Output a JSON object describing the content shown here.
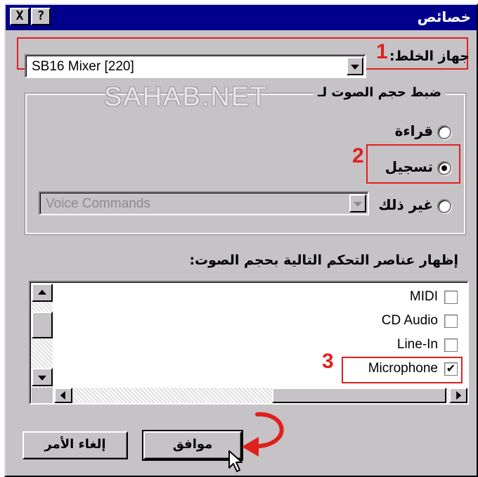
{
  "window": {
    "title": "خصائص",
    "close_glyph": "X",
    "help_glyph": "?"
  },
  "mixer_device": {
    "label": "جهاز الخلط:",
    "value": "SB16 Mixer [220]"
  },
  "volume_group": {
    "title": "ضبط حجم الصوت لـ",
    "options": [
      {
        "label": "قراءة",
        "checked": false
      },
      {
        "label": "تسجيل",
        "checked": true
      },
      {
        "label": "غير ذلك",
        "checked": false
      }
    ],
    "other_value": "Voice Commands"
  },
  "watermark": "SAHAB.NET",
  "controls_list": {
    "label": "إظهار عناصر التحكم التالية بحجم الصوت:",
    "items": [
      {
        "label": "MIDI",
        "checked": false
      },
      {
        "label": "CD Audio",
        "checked": false
      },
      {
        "label": "Line-In",
        "checked": false
      },
      {
        "label": "Microphone",
        "checked": true
      }
    ]
  },
  "buttons": {
    "ok": "موافق",
    "cancel": "إلغاء الأمر"
  },
  "annotations": [
    "1",
    "2",
    "3"
  ],
  "colors": {
    "dialog_bg": "#c6c3c6",
    "titlebar": "#00008c",
    "annotation": "#e0201c"
  },
  "icons": {
    "close": "close-icon",
    "help": "help-icon",
    "pointer": "mouse-pointer-icon",
    "arrow": "curved-arrow-icon"
  }
}
